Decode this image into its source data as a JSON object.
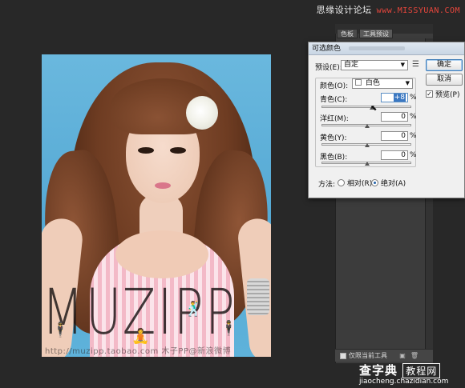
{
  "watermark_top": {
    "text": "思缘设计论坛",
    "url": "www.MISSYUAN.COM"
  },
  "photo": {
    "overlay_text": "MUZIPP",
    "overlay_url": "http://muzipp.taobao.com  木子PP@新浪微博"
  },
  "panel": {
    "tabs": [
      "色板",
      "工具预设"
    ],
    "footer_checkbox_label": "仅限当前工具"
  },
  "dialog": {
    "title": "可选颜色",
    "preset_label": "预设(E):",
    "preset_value": "自定",
    "colors_label": "颜色(O):",
    "colors_value": "白色",
    "ok_label": "确定",
    "cancel_label": "取消",
    "preview_label": "预览(P)",
    "preview_checked": true,
    "sliders": [
      {
        "label": "青色(C):",
        "value": "+8",
        "unit": "%",
        "position": 0.54
      },
      {
        "label": "洋红(M):",
        "value": "0",
        "unit": "%",
        "position": 0.5
      },
      {
        "label": "黄色(Y):",
        "value": "0",
        "unit": "%",
        "position": 0.5
      },
      {
        "label": "黑色(B):",
        "value": "0",
        "unit": "%",
        "position": 0.5
      }
    ],
    "method_label": "方法:",
    "method_options": [
      "相对(R)",
      "绝对(A)"
    ],
    "method_selected": 1
  },
  "watermark_bottom": {
    "brand": "查字典",
    "brand_box": "教程网",
    "url": "jiaocheng.chazidian.com"
  }
}
